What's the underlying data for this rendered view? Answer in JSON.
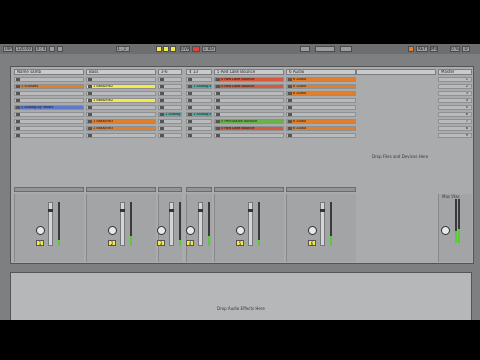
{
  "transport": {
    "tap": "TAP",
    "tempo": "120.00",
    "time_sig": "4 / 4",
    "loop_label": "1 Bar",
    "rec": "OVR",
    "position": "1 . 1 . 1",
    "key": "KEY",
    "midi": "MIDI",
    "cpu": "0 %",
    "d": "D"
  },
  "tracks": [
    {
      "name": "Name samb",
      "clips": [
        "",
        "1 Sunsets",
        "",
        "",
        "3 Analog by Yardis",
        "",
        "",
        "",
        ""
      ],
      "num": "1"
    },
    {
      "name": "Bass",
      "clips": [
        "",
        "1 Bassline2",
        "",
        "1 Bassline2",
        "",
        "",
        "1 Bassline3",
        "1 Bassline3",
        ""
      ],
      "num": "2"
    },
    {
      "name": "3-6",
      "clips": [
        "",
        "",
        "",
        "",
        "",
        "1 Analog Bass",
        "",
        "",
        ""
      ],
      "num": "3"
    },
    {
      "name": "4 13",
      "clips": [
        "",
        "1 Analog Bass",
        "",
        "",
        "",
        "1 Analog Bass",
        "",
        "",
        ""
      ],
      "num": "4"
    },
    {
      "name": "5 Red Lake Bounce",
      "clips": [
        "5 Red Lake Bounce",
        "5 Red Lake Bounce",
        "",
        "",
        "",
        "",
        "5 Percussion Bounce",
        "5 Red Lake Bounce",
        ""
      ],
      "num": "5"
    },
    {
      "name": "6 Audio",
      "clips": [
        "6 Audio",
        "6 Audio",
        "6 Audio",
        "",
        "",
        "",
        "6 Audio",
        "6 Audio",
        ""
      ],
      "num": "6"
    }
  ],
  "drop_files": "Drop Files and Devices Here",
  "drop_audio": "Drop Audio Effects Here",
  "master": {
    "name": "Master",
    "scenes": [
      "1",
      "2",
      "3",
      "4",
      "5",
      "6",
      "7",
      "8",
      "9"
    ],
    "num": "A1",
    "label": "Mas Vlas"
  },
  "colors": {
    "orange": "#e0802e",
    "yellow": "#f3e94a",
    "green": "#6ab24a",
    "teal": "#3fb6b0",
    "blue": "#5f78c8",
    "red": "#d85a3a"
  }
}
